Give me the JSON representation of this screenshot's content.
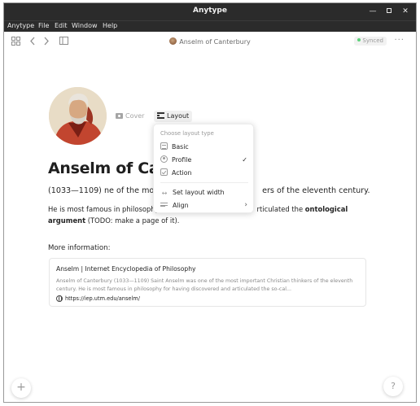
{
  "window": {
    "title": "Anytype"
  },
  "menubar": [
    "Anytype",
    "File",
    "Edit",
    "Window",
    "Help"
  ],
  "header": {
    "breadcrumb": "Anselm of Canterbury",
    "sync_status": "Synced",
    "more": "···"
  },
  "object": {
    "cover_label": "Cover",
    "layout_label": "Layout",
    "title": "Anselm of Canterbury",
    "title_visible": "Anselm of Ca",
    "subline_left": "(1033—1109) ",
    "subline_mid": "ne of the most",
    "subline_right": "ers of the eleventh century.",
    "para_part1": "He is most famous in philosophy",
    "para_part2": "rticulated the ",
    "para_bold": "ontological argument",
    "para_part3": " (TODO: make a page of it).",
    "more_info": "More information:"
  },
  "bookmark": {
    "title": "Anselm | Internet Encyclopedia of Philosophy",
    "description": "Anselm of Canterbury (1033—1109) Saint Anselm was one of the most important Christian thinkers of the eleventh century. He is most famous in philosophy for having discovered and articulated the so-cal...",
    "url": "https://iep.utm.edu/anselm/"
  },
  "layout_menu": {
    "heading": "Choose layout type",
    "items": [
      {
        "label": "Basic",
        "icon": "basic-layout-icon",
        "selected": false
      },
      {
        "label": "Profile",
        "icon": "profile-layout-icon",
        "selected": true
      },
      {
        "label": "Action",
        "icon": "action-layout-icon",
        "selected": false
      }
    ],
    "set_width": "Set layout width",
    "align": "Align"
  },
  "fab": {
    "plus": "+",
    "help": "?"
  },
  "colors": {
    "synced_dot": "#5dd27a",
    "titlebar": "#2b2b2b"
  }
}
